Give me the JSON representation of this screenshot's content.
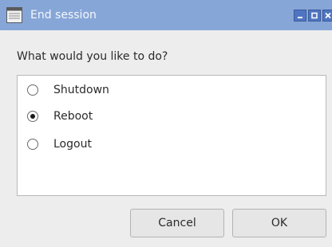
{
  "window": {
    "title": "End session",
    "title_bar_color": "#87a6d8",
    "icon": "window-app-icon",
    "controls": {
      "minimize_icon": "minimize-icon",
      "maximize_icon": "maximize-icon",
      "close_icon": "close-icon"
    }
  },
  "dialog": {
    "prompt": "What would you like to do?",
    "options": [
      {
        "label": "Shutdown",
        "selected": false
      },
      {
        "label": "Reboot",
        "selected": true
      },
      {
        "label": "Logout",
        "selected": false
      }
    ],
    "buttons": {
      "cancel_label": "Cancel",
      "ok_label": "OK"
    }
  }
}
